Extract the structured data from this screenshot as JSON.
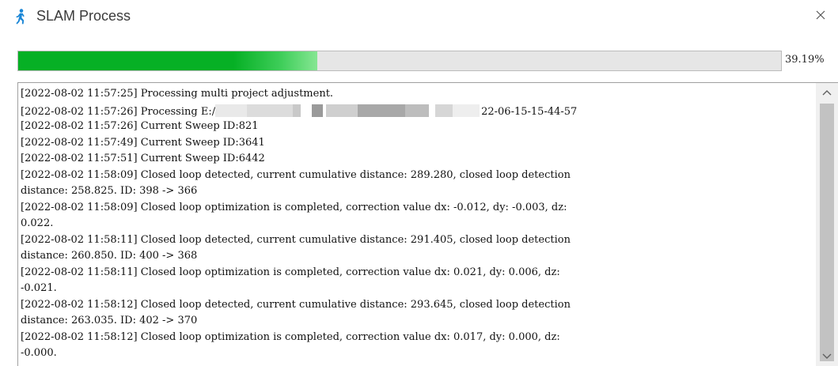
{
  "window": {
    "title": "SLAM Process",
    "icon": "running-person-icon",
    "close_icon": "close-icon"
  },
  "progress": {
    "value_percent": 39.19,
    "label": "39.19%",
    "fill_color": "#06b025"
  },
  "log": {
    "lines": [
      "[2022-08-02 11:57:25] Processing multi project adjustment.",
      {
        "prefix": "[2022-08-02 11:57:26] Processing E:/",
        "suffix": "22-06-15-15-44-57"
      },
      "[2022-08-02 11:57:26] Current Sweep ID:821",
      "[2022-08-02 11:57:49] Current Sweep ID:3641",
      "[2022-08-02 11:57:51] Current Sweep ID:6442",
      "[2022-08-02 11:58:09] Closed loop detected, current cumulative distance: 289.280, closed loop detection",
      "distance: 258.825. ID: 398 -> 366",
      "[2022-08-02 11:58:09] Closed loop optimization is completed, correction value dx: -0.012, dy: -0.003, dz:",
      "0.022.",
      "[2022-08-02 11:58:11] Closed loop detected, current cumulative distance: 291.405, closed loop detection",
      "distance: 260.850. ID: 400 -> 368",
      "[2022-08-02 11:58:11] Closed loop optimization is completed, correction value dx: 0.021, dy: 0.006, dz:",
      "-0.021.",
      "[2022-08-02 11:58:12] Closed loop detected, current cumulative distance: 293.645, closed loop detection",
      "distance: 263.035. ID: 402 -> 370",
      "[2022-08-02 11:58:12] Closed loop optimization is completed, correction value dx: 0.017, dy: 0.000, dz:",
      "-0.000."
    ]
  }
}
